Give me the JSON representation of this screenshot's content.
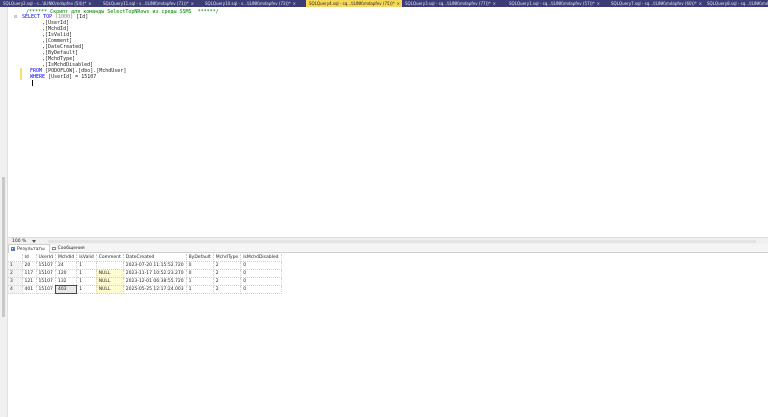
{
  "tabs": [
    {
      "label": "SQLQuery2.sql - s...\\ILINK\\mdapfev (54))*",
      "active": false
    },
    {
      "label": "SQLQuery11.sql - s...\\ILINK\\mdapfev (71))*",
      "active": false
    },
    {
      "label": "SQLQuery10.sql - s...\\ILINK\\mdapfev (73))*",
      "active": false
    },
    {
      "label": "SQLQuery4.sql - sq...\\ILINK\\mdapfev (75))*",
      "active": true
    },
    {
      "label": "SQLQuery3.sql - sq...\\ILINK\\mdapfev (77))*",
      "active": false
    },
    {
      "label": "SQLQuery1.sql - sq...\\ILINK\\mdapfev (57))*",
      "active": false
    },
    {
      "label": "SQLQuery7.sql - sq...\\ILINK\\mdapfev (60))*",
      "active": false
    },
    {
      "label": "SQLQuery8.sql - sq...\\ILINK\\mdapfev (56))*",
      "active": false
    }
  ],
  "editor": {
    "comment": "/****** Скрипт для команды SelectTopNRows из среды SSMS  ******/",
    "select_kw": "SELECT",
    "top_kw": "TOP",
    "top_value": "(1000)",
    "col_first": "[Id]",
    "columns": [
      ",[UserId]",
      ",[MchdId]",
      ",[IsValid]",
      ",[Comment]",
      ",[DateCreated]",
      ",[ByDefault]",
      ",[MchdType]",
      ",[IsMchdDisabled]"
    ],
    "from_kw": "FROM",
    "from_table": "[PODOFLOW].[dbo].[MchdUser]",
    "where_kw": "WHERE",
    "where_expr": "[UserId] = 15107"
  },
  "zoom": "100 %",
  "results_tabs": {
    "results": "Результаты",
    "messages": "Сообщения"
  },
  "grid": {
    "columns": [
      "Id",
      "UserId",
      "MchdId",
      "IsValid",
      "Comment",
      "DateCreated",
      "ByDefault",
      "MchdType",
      "IsMchdDisabled"
    ],
    "rows": [
      {
        "n": "1",
        "cells": [
          "20",
          "15107",
          "24",
          "1",
          "",
          "2023-07-20 11:15:52.720",
          "0",
          "2",
          "0"
        ]
      },
      {
        "n": "2",
        "cells": [
          "117",
          "15107",
          "120",
          "1",
          "NULL",
          "2023-11-17 10:52:23.270",
          "0",
          "2",
          "0"
        ]
      },
      {
        "n": "3",
        "cells": [
          "121",
          "15107",
          "132",
          "1",
          "NULL",
          "2023-12-01 06:38:55.720",
          "1",
          "2",
          "0"
        ]
      },
      {
        "n": "4",
        "cells": [
          "401",
          "15107",
          "403",
          "1",
          "NULL",
          "2025-05-25 12:17:24.003",
          "1",
          "2",
          "0"
        ]
      }
    ]
  }
}
